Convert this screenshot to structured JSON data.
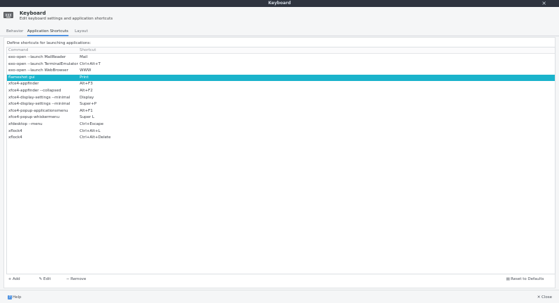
{
  "window": {
    "title": "Keyboard",
    "close_glyph": "×"
  },
  "header": {
    "title": "Keyboard",
    "subtitle": "Edit keyboard settings and application shortcuts",
    "icon": "keyboard-icon"
  },
  "tabs": [
    {
      "label": "Behavior",
      "active": false
    },
    {
      "label": "Application Shortcuts",
      "active": true
    },
    {
      "label": "Layout",
      "active": false
    }
  ],
  "main": {
    "description": "Define shortcuts for launching applications:",
    "columns": {
      "command": "Command",
      "shortcut": "Shortcut"
    },
    "rows": [
      {
        "command": "exo-open --launch MailReader",
        "shortcut": "Mail"
      },
      {
        "command": "exo-open --launch TerminalEmulator",
        "shortcut": "Ctrl+Alt+T"
      },
      {
        "command": "exo-open --launch WebBrowser",
        "shortcut": "WWW"
      },
      {
        "command": "flameshot gui",
        "shortcut": "Print"
      },
      {
        "command": "xfce4-appfinder",
        "shortcut": "Alt+F3"
      },
      {
        "command": "xfce4-appfinder --collapsed",
        "shortcut": "Alt+F2"
      },
      {
        "command": "xfce4-display-settings --minimal",
        "shortcut": "Display"
      },
      {
        "command": "xfce4-display-settings --minimal",
        "shortcut": "Super+P"
      },
      {
        "command": "xfce4-popup-applicationsmenu",
        "shortcut": "Alt+F1"
      },
      {
        "command": "xfce4-popup-whiskermenu",
        "shortcut": "Super L"
      },
      {
        "command": "xfdesktop --menu",
        "shortcut": "Ctrl+Escape"
      },
      {
        "command": "xflock4",
        "shortcut": "Ctrl+Alt+L"
      },
      {
        "command": "xflock4",
        "shortcut": "Ctrl+Alt+Delete"
      }
    ],
    "selected_index": 3
  },
  "actions": {
    "add": "Add",
    "edit": "Edit",
    "remove": "Remove",
    "reset": "Reset to Defaults"
  },
  "footer": {
    "help": "Help",
    "close": "Close"
  },
  "colors": {
    "selection": "#1ab3cb",
    "accent": "#5294e2",
    "titlebar": "#2f343f"
  }
}
